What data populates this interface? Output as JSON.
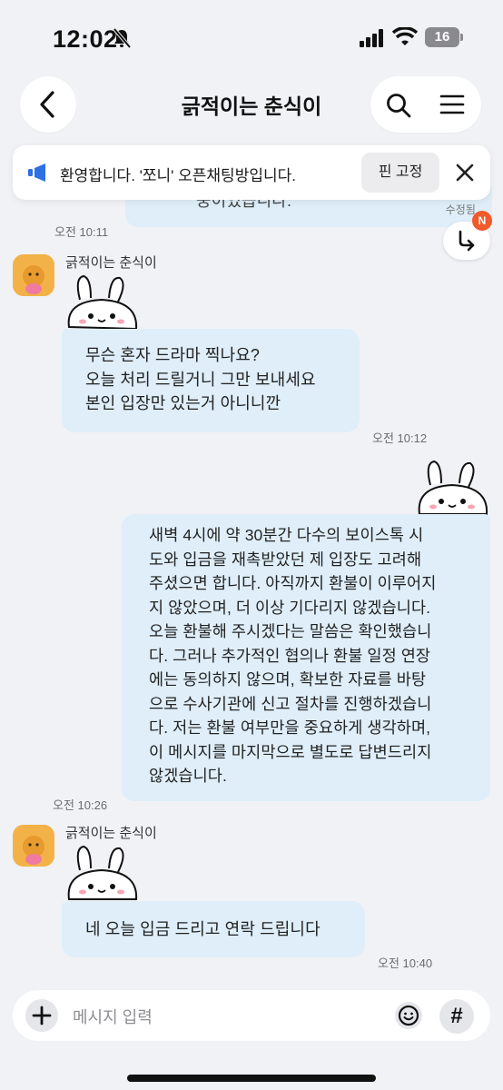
{
  "status_bar": {
    "time": "12:02",
    "battery": "16"
  },
  "header": {
    "title": "긁적이는 춘식이"
  },
  "notice": {
    "text": "환영합니다. '쪼니' 오픈채팅방입니다.",
    "pin_label": "핀 고정"
  },
  "messages": {
    "prev": {
      "partial_text": "중이었습니다.",
      "status": "수정됨",
      "time": "오전 10:11"
    },
    "m1": {
      "sender": "긁적이는 춘식이",
      "lines": [
        "무슨 혼자 드라마 찍나요?",
        "오늘 처리 드릴거니 그만 보내세요",
        "본인 입장만 있는거 아니니깐"
      ],
      "time": "오전 10:12"
    },
    "m2": {
      "lines": [
        "새벽 4시에 약 30분간 다수의 보이스톡 시",
        "도와 입금을 재촉받았던 제 입장도 고려해",
        "주셨으면 합니다. 아직까지 환불이 이루어지",
        "지 않았으며, 더 이상 기다리지 않겠습니다.",
        "오늘 환불해 주시겠다는 말씀은 확인했습니",
        "다. 그러나 추가적인 협의나 환불 일정 연장",
        "에는 동의하지 않으며, 확보한 자료를 바탕",
        "으로 수사기관에 신고 절차를 진행하겠습니",
        "다. 저는 환불 여부만을 중요하게 생각하며,",
        "이 메시지를 마지막으로 별도로 답변드리지",
        "않겠습니다."
      ],
      "time": "오전 10:26"
    },
    "m3": {
      "sender": "긁적이는 춘식이",
      "text": "네 오늘 입금 드리고 연락 드립니다",
      "time": "오전 10:40"
    }
  },
  "reply_badge": "N",
  "input": {
    "placeholder": "메시지 입력",
    "hash_label": "#"
  },
  "icons": [
    "bell-slash-icon",
    "signal-icon",
    "wifi-icon",
    "back-icon",
    "search-icon",
    "menu-icon",
    "megaphone-icon",
    "close-icon",
    "reply-arrow-icon",
    "plus-icon",
    "emoji-icon"
  ],
  "colors": {
    "bubble": "#dfeef9",
    "background": "#f1f2f6",
    "accent": "#2f6fe4",
    "badge": "#f15a2b"
  }
}
